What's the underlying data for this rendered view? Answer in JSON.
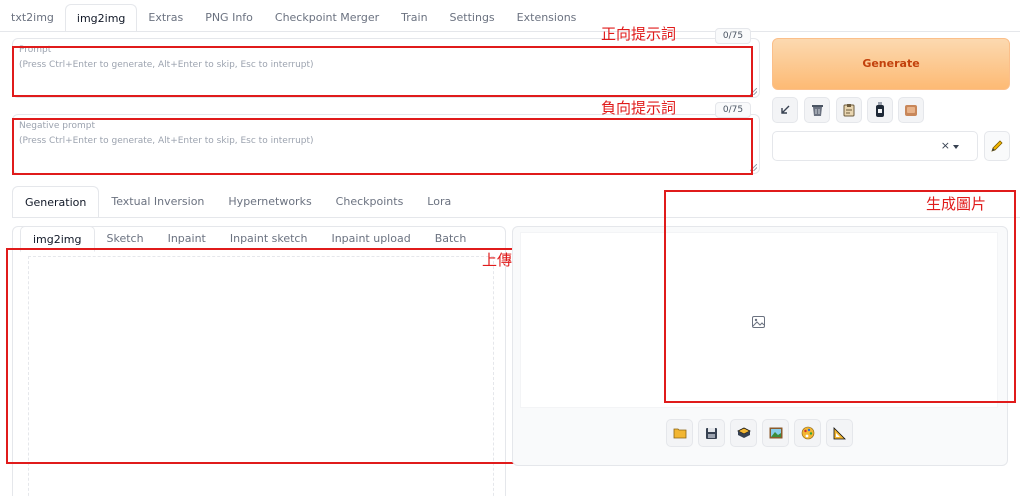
{
  "top_tabs": [
    "txt2img",
    "img2img",
    "Extras",
    "PNG Info",
    "Checkpoint Merger",
    "Train",
    "Settings",
    "Extensions"
  ],
  "prompt": {
    "label": "Prompt",
    "placeholder": "(Press Ctrl+Enter to generate, Alt+Enter to skip, Esc to interrupt)",
    "counter": "0/75"
  },
  "negative_prompt": {
    "label": "Negative prompt",
    "placeholder": "(Press Ctrl+Enter to generate, Alt+Enter to skip, Esc to interrupt)",
    "counter": "0/75"
  },
  "generate_label": "Generate",
  "style_clear": "×",
  "generation_tabs": [
    "Generation",
    "Textual Inversion",
    "Hypernetworks",
    "Checkpoints",
    "Lora"
  ],
  "img2img_tabs": [
    "img2img",
    "Sketch",
    "Inpaint",
    "Inpaint sketch",
    "Inpaint upload",
    "Batch"
  ],
  "annotations": {
    "positive_prompt": "正向提示詞",
    "negative_prompt": "負向提示詞",
    "upload_image": "上傳圖片",
    "generated_image": "生成圖片"
  },
  "icons": {
    "tool_buttons": [
      "arrow-icon",
      "trash-icon",
      "clipboard-icon",
      "bottle-icon",
      "style-box-icon"
    ],
    "output_buttons": [
      "folder-icon",
      "save-icon",
      "zip-icon",
      "image-icon",
      "palette-icon",
      "ruler-icon"
    ]
  },
  "colors": {
    "annotation_red": "#e01b1b",
    "generate_bg": "#fdba74",
    "generate_text": "#c2410c"
  }
}
